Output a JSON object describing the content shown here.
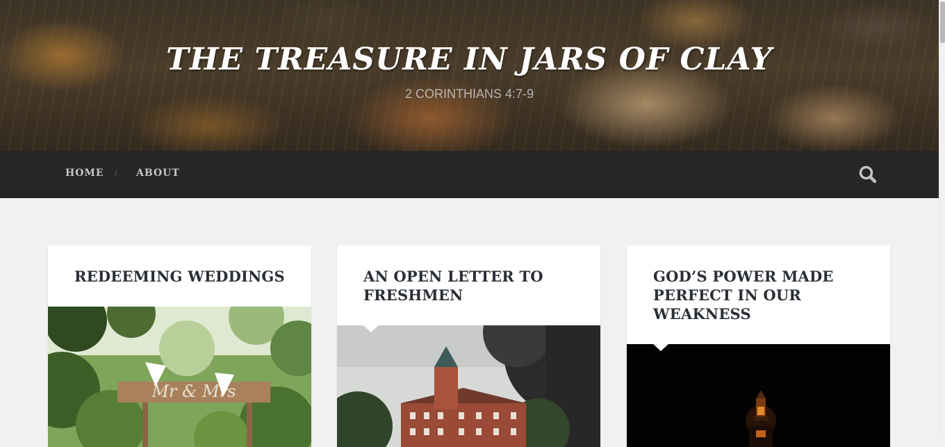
{
  "site": {
    "title": "THE TREASURE IN JARS OF CLAY",
    "description": "2 CORINTHIANS 4:7-9"
  },
  "nav": {
    "items": [
      {
        "label": "HOME"
      },
      {
        "label": "ABOUT"
      }
    ],
    "separator": "/",
    "search_icon": "search-icon"
  },
  "posts": [
    {
      "title": "REDEEMING WEDDINGS",
      "image": "wedding-sign-image"
    },
    {
      "title": "AN OPEN LETTER TO FRESHMEN",
      "image": "brick-building-image"
    },
    {
      "title": "GOD’S POWER MADE PERFECT IN OUR WEAKNESS",
      "image": "dark-lantern-image"
    }
  ],
  "colors": {
    "nav_bg": "#262626",
    "page_bg": "#f1f1f1",
    "title_text": "#2a2f36"
  }
}
